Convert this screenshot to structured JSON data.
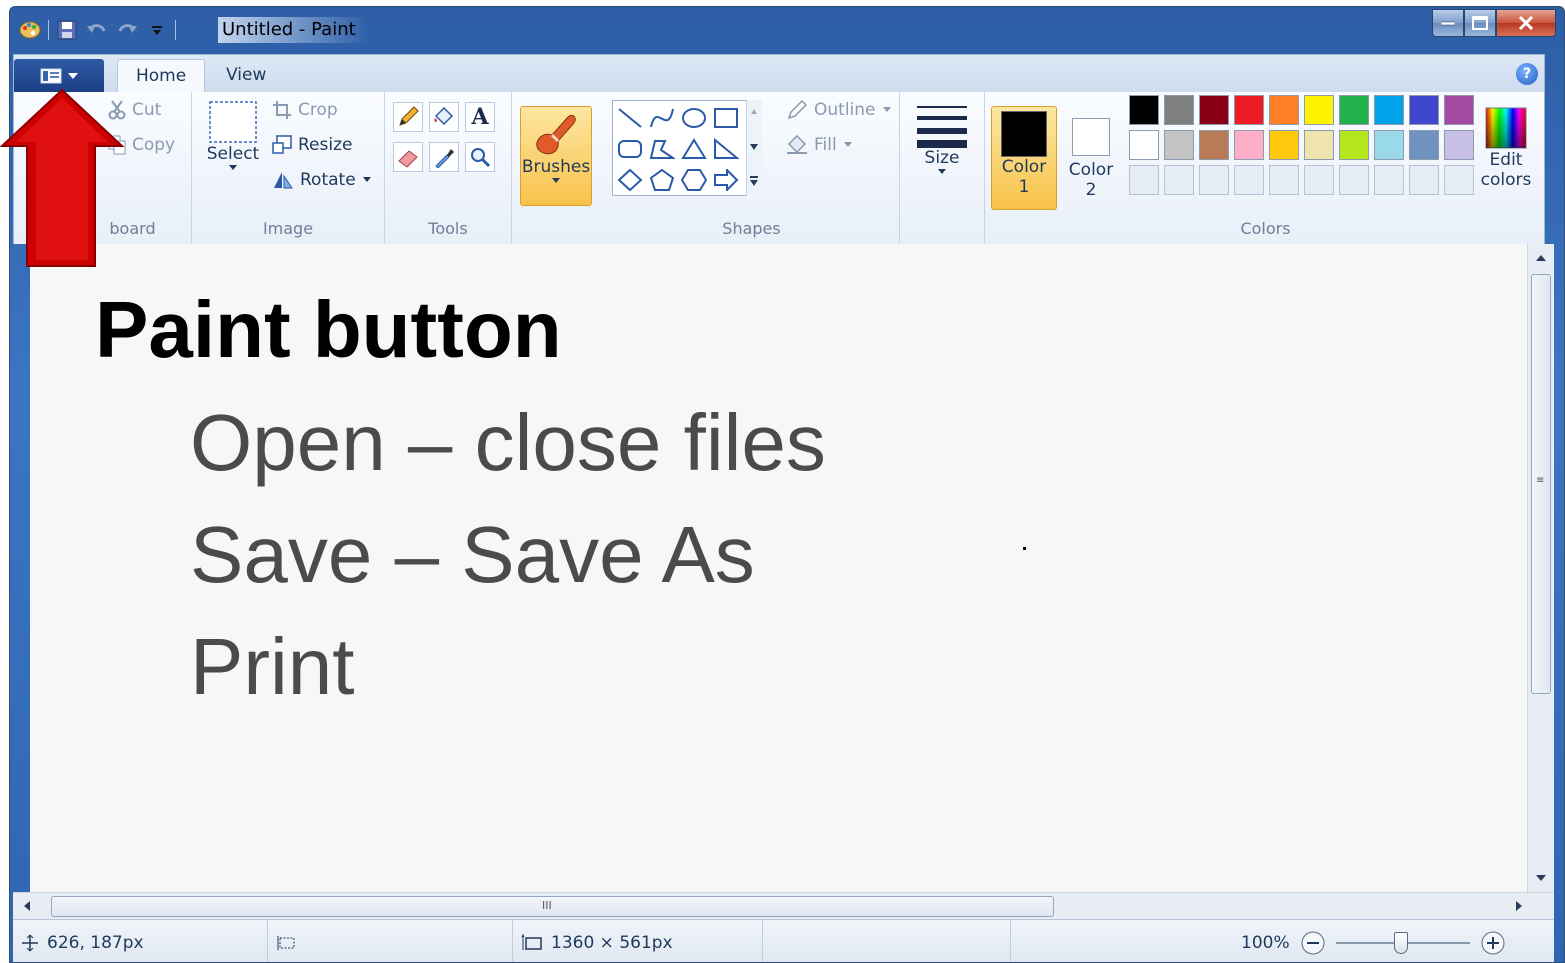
{
  "window": {
    "title": "Untitled - Paint",
    "controls": [
      "minimize-icon",
      "maximize-icon",
      "close-icon"
    ]
  },
  "quick_access": {
    "icons": [
      "paint-app-icon",
      "save-icon",
      "undo-icon",
      "redo-icon",
      "customize-dropdown-icon"
    ]
  },
  "tabs": [
    {
      "label": "Home",
      "active": true
    },
    {
      "label": "View",
      "active": false
    }
  ],
  "ribbon": {
    "clipboard": {
      "label": "Clipboard",
      "visible_label": "board",
      "cut": "Cut",
      "copy": "Copy"
    },
    "image": {
      "label": "Image",
      "select": "Select",
      "crop": "Crop",
      "resize": "Resize",
      "rotate": "Rotate"
    },
    "tools": {
      "label": "Tools",
      "icons": [
        "pencil-icon",
        "fill-bucket-icon",
        "text-icon",
        "eraser-icon",
        "color-picker-icon",
        "magnifier-icon"
      ]
    },
    "brushes": {
      "label": "Brushes"
    },
    "shapes": {
      "label": "Shapes",
      "outline": "Outline",
      "fill": "Fill"
    },
    "size": {
      "label": "Size"
    },
    "colors": {
      "label": "Colors",
      "color1": {
        "line1": "Color",
        "line2": "1",
        "value": "#000000"
      },
      "color2": {
        "line1": "Color",
        "line2": "2",
        "value": "#ffffff"
      },
      "edit_line1": "Edit",
      "edit_line2": "colors",
      "palette_row1": [
        "#000000",
        "#7f7f7f",
        "#880015",
        "#ed1c24",
        "#ff7f27",
        "#fff200",
        "#22b14c",
        "#00a2e8",
        "#3f48cc",
        "#a349a4"
      ],
      "palette_row2": [
        "#ffffff",
        "#c3c3c3",
        "#b97a57",
        "#ffaec9",
        "#ffc90e",
        "#efe4b0",
        "#b5e61d",
        "#99d9ea",
        "#7092be",
        "#c8bfe7"
      ]
    }
  },
  "slide": {
    "title": "Paint button",
    "lines": [
      "Open – close files",
      "Save – Save As",
      "Print"
    ]
  },
  "status": {
    "cursor_pos": "626, 187px",
    "image_size": "1360 × 561px",
    "zoom": "100%"
  },
  "scroll": {
    "h_thumb_label": "III",
    "v_thumb_label": "≡"
  },
  "accent": {
    "arrow_color": "#cc0000",
    "paint_button_color": "#1f4489",
    "selected_color_highlight": "#fbd069"
  }
}
